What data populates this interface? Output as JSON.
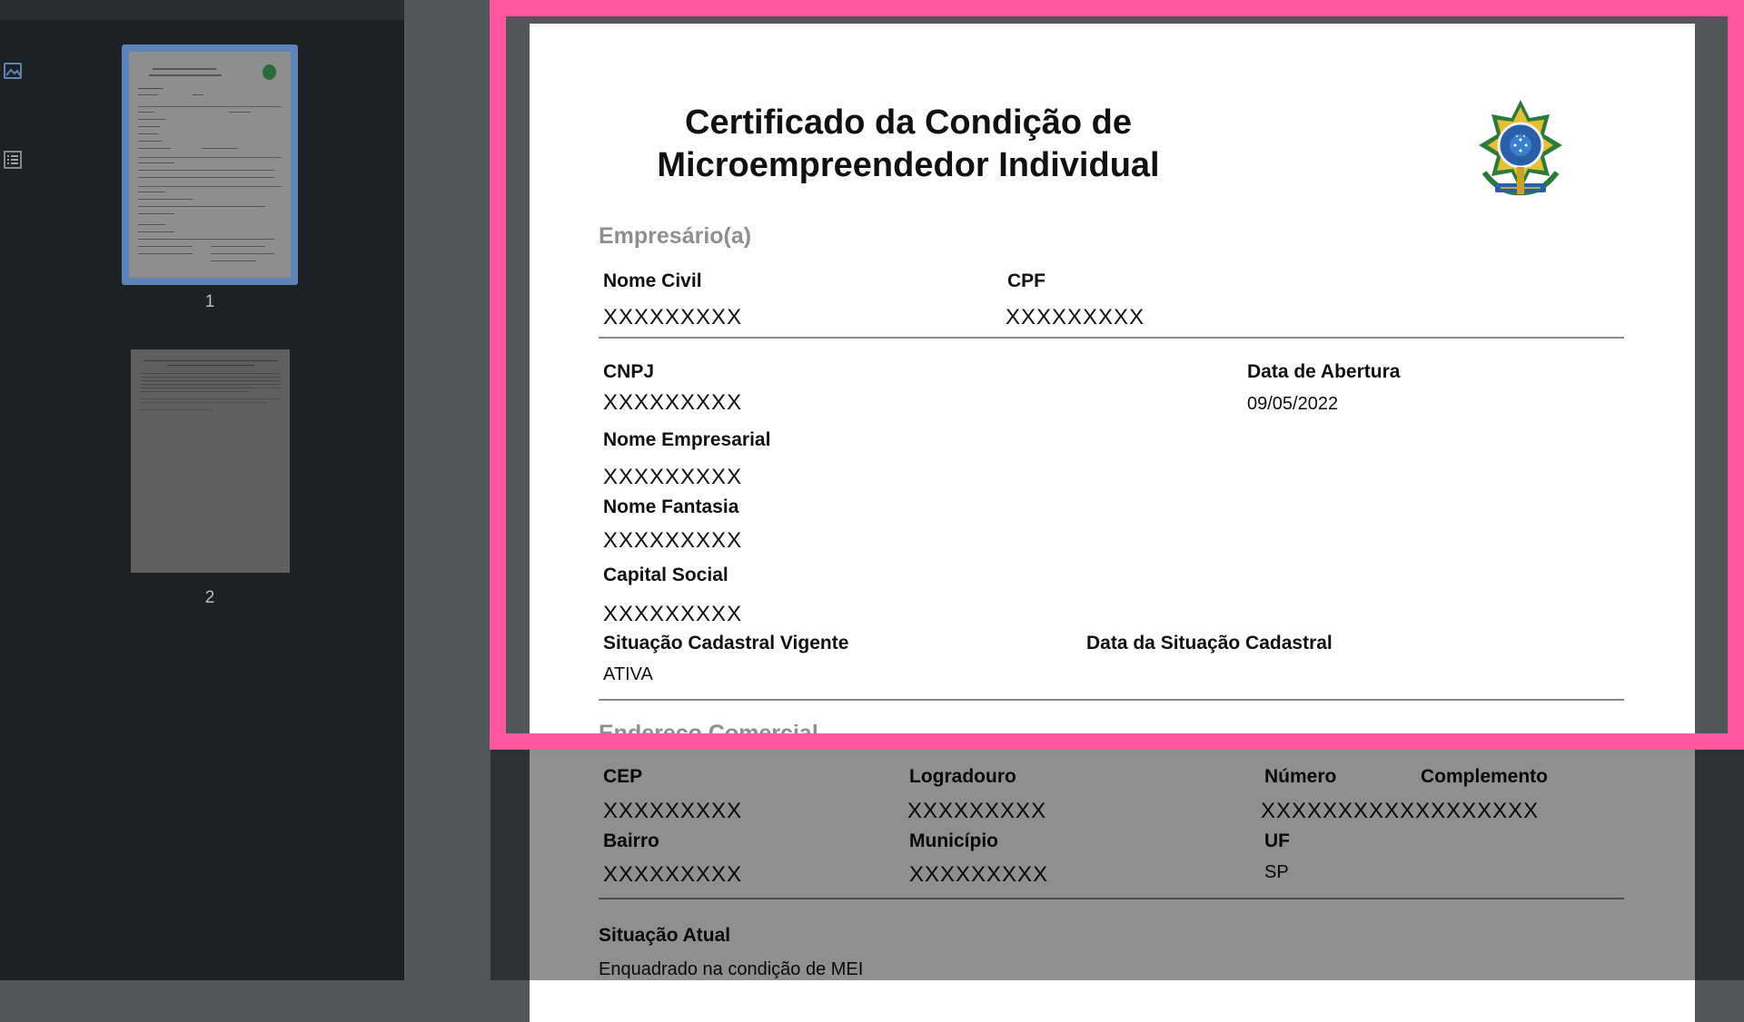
{
  "thumbnails": {
    "pages": [
      {
        "number": "1",
        "selected": true
      },
      {
        "number": "2",
        "selected": false
      }
    ]
  },
  "sidebar_icons": [
    "thumbnails-icon",
    "outline-icon"
  ],
  "document": {
    "title_line1": "Certificado da Condição de",
    "title_line2": "Microempreendedor Individual",
    "section_empresario": "Empresário(a)",
    "nome_civil": {
      "label": "Nome Civil",
      "value": "XXXXXXXXX"
    },
    "cpf": {
      "label": "CPF",
      "value": "XXXXXXXXX"
    },
    "cnpj": {
      "label": "CNPJ",
      "value": "XXXXXXXXX"
    },
    "data_abertura": {
      "label": "Data de Abertura",
      "value": "09/05/2022"
    },
    "nome_empresarial": {
      "label": "Nome Empresarial",
      "value": "XXXXXXXXX"
    },
    "nome_fantasia": {
      "label": "Nome Fantasia",
      "value": "XXXXXXXXX"
    },
    "capital_social": {
      "label": "Capital Social",
      "value": "XXXXXXXXX"
    },
    "situacao_cadastral": {
      "label": "Situação Cadastral Vigente",
      "value": "ATIVA"
    },
    "data_situacao": {
      "label": "Data da Situação Cadastral",
      "value": ""
    },
    "section_endereco": "Endereço Comercial",
    "cep": {
      "label": "CEP",
      "value": "XXXXXXXXX"
    },
    "logradouro": {
      "label": "Logradouro",
      "value": "XXXXXXXXX"
    },
    "numero": {
      "label": "Número",
      "value": "XXXXXXXXXXXXXXXXXX"
    },
    "complemento": {
      "label": "Complemento"
    },
    "bairro": {
      "label": "Bairro",
      "value": "XXXXXXXXX"
    },
    "municipio": {
      "label": "Município",
      "value": "XXXXXXXXX"
    },
    "uf": {
      "label": "UF",
      "value": "SP"
    },
    "situacao_atual": {
      "label": "Situação Atual",
      "value": "Enquadrado na condição de MEI"
    }
  },
  "colors": {
    "highlight": "#ff579f",
    "thumb_selected": "#5d83b7",
    "sidebar_bg": "#1e2124",
    "viewer_bg": "#525659"
  }
}
